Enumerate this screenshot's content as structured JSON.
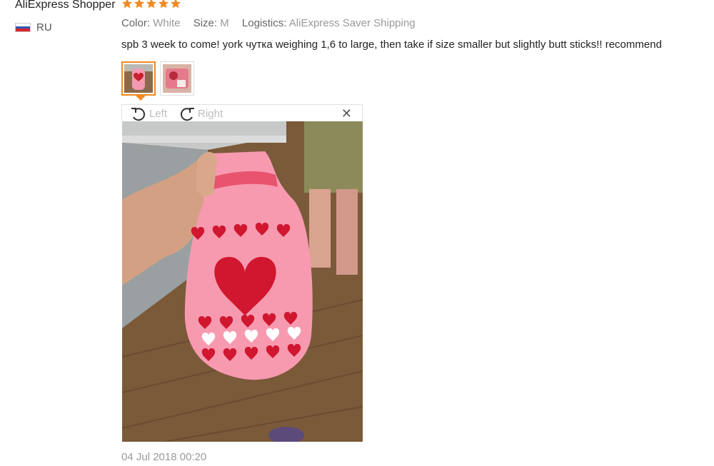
{
  "review": {
    "user_name": "AliExpress Shopper",
    "rating": 5,
    "country": "RU",
    "attributes": [
      {
        "key": "Color:",
        "value": "White"
      },
      {
        "key": "Size:",
        "value": "M"
      },
      {
        "key": "Logistics:",
        "value": "AliExpress Saver Shipping"
      }
    ],
    "text": "spb 3 week to come! york чутка weighing 1,6 to large, then take if size smaller but slightly butt sticks!! recommend",
    "thumbnails": [
      {
        "name": "photo-thumbnail-1",
        "selected": true
      },
      {
        "name": "photo-thumbnail-2",
        "selected": false
      }
    ],
    "viewer": {
      "rotate_left_label": "Left",
      "rotate_right_label": "Right",
      "close_icon": "close-icon"
    },
    "date": "04 Jul 2018 00:20"
  },
  "colors": {
    "star": "#f08a24",
    "accent": "#f08a24",
    "flag_white": "#ffffff",
    "flag_blue": "#2f55b5",
    "flag_red": "#d7262b"
  }
}
